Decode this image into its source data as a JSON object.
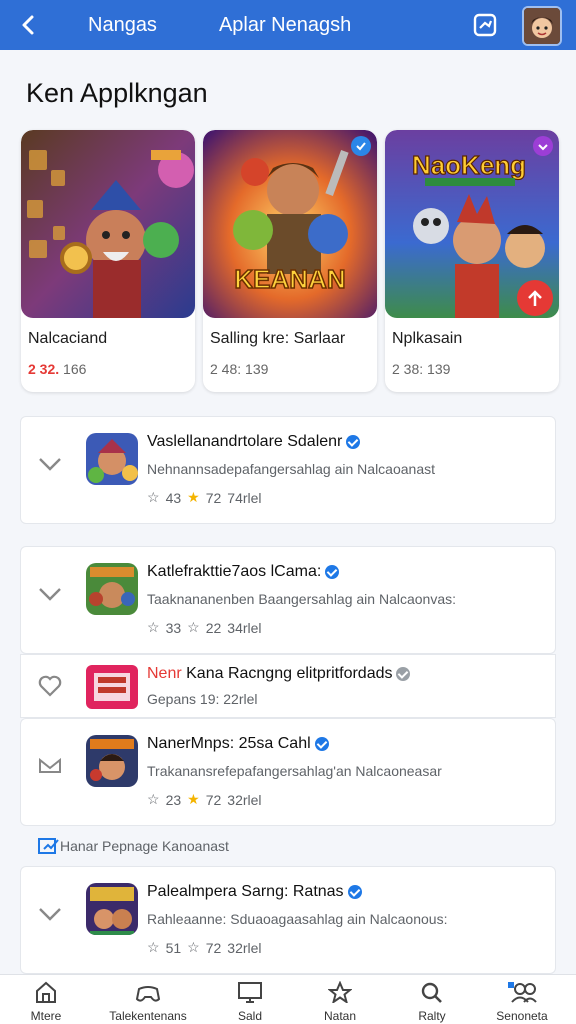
{
  "header": {
    "left_title": "Nangas",
    "center_title": "Aplar Nenagsh"
  },
  "section_title": "Ken Applkngan",
  "featured": [
    {
      "name": "Nalcaciand",
      "meta_highlight": "2 32.",
      "meta_rest": " 166",
      "art": "fantasy-heroes",
      "badge": ""
    },
    {
      "name": "Salling kre: Sarlaar",
      "meta_highlight": "",
      "meta_rest": "2 48: 139",
      "art": "kreanan-heroes",
      "badge": "verified",
      "art_text": "KEANAN"
    },
    {
      "name": "Nplkasain",
      "meta_highlight": "",
      "meta_rest": "2 38: 139",
      "art": "nakeng-heroes",
      "badge": "purple",
      "art_text": "NaoKeng"
    }
  ],
  "list": [
    {
      "title": "Vaslellanandrtolare Sdalenr",
      "title_red": "",
      "desc": "Nehnannsadepafangersahlag ain Nalcaoanast",
      "stats": [
        "43",
        "72",
        "74rlel"
      ],
      "verified": true
    },
    {
      "title": "Katlefrakttie7aos lCama:",
      "title_red": "",
      "desc": "Taaknananenben Baangersahlag ain Nalcaonvas:",
      "stats": [
        "33",
        "22",
        "34rlel"
      ],
      "verified": true
    },
    {
      "title": " Kana Racngng elitpritfordads",
      "title_red": "Nenr",
      "desc": "Gepans 19: 22rlel",
      "stats": [],
      "verified": false
    },
    {
      "title": "NanerMnps: 25sa Cahl",
      "title_red": "",
      "desc": "Trakanansrefepafangersahlag'an Nalcaoneasar",
      "stats": [
        "23",
        "72",
        "32rlel"
      ],
      "verified": true
    },
    {
      "title": "Palealmpera Sarng: Ratnas",
      "title_red": "",
      "desc": "Rahleaanne: Sduaoagaasahlag ain Nalcaonous:",
      "stats": [
        "51",
        "72",
        "32rlel"
      ],
      "verified": true
    }
  ],
  "subhead": "Hanar Pepnage Kanoanast",
  "bottom_nav": [
    {
      "label": "Mtere",
      "icon": "home-icon"
    },
    {
      "label": "Talekentenans",
      "icon": "controller-icon"
    },
    {
      "label": "Sald",
      "icon": "tv-icon"
    },
    {
      "label": "Natan",
      "icon": "star-icon"
    },
    {
      "label": "Ralty",
      "icon": "search-icon"
    },
    {
      "label": "Senoneta",
      "icon": "people-icon"
    }
  ],
  "colors": {
    "primary": "#2f6fd6",
    "accent_red": "#e53935",
    "verified": "#1e78e6"
  }
}
